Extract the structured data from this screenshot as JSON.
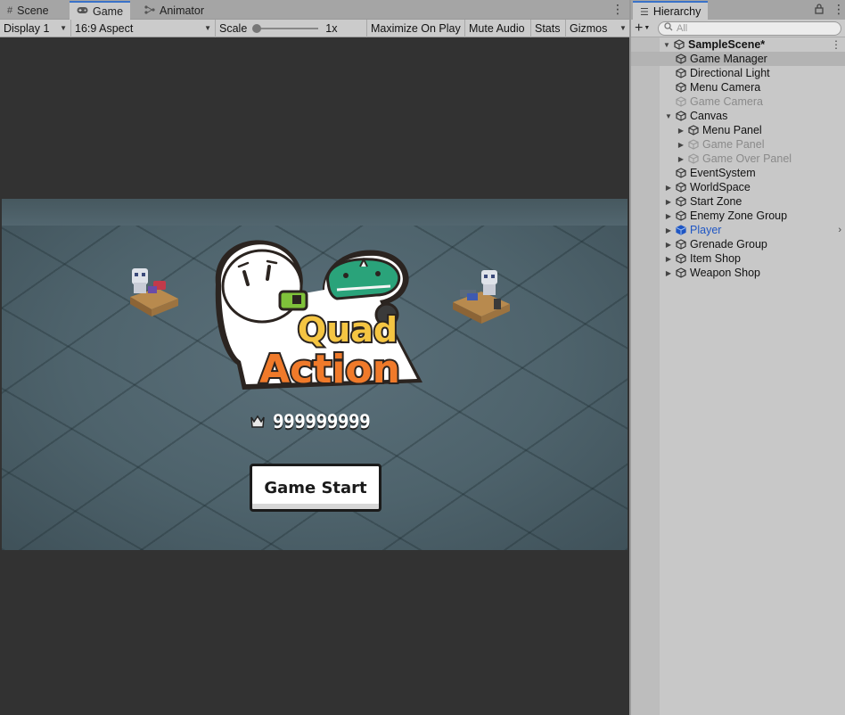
{
  "tabs": {
    "scene": "Scene",
    "game": "Game",
    "animator": "Animator"
  },
  "game_toolbar": {
    "display": "Display 1",
    "aspect": "16:9 Aspect",
    "scale_label": "Scale",
    "scale_value": "1x",
    "maximize": "Maximize On Play",
    "mute": "Mute Audio",
    "stats": "Stats",
    "gizmos": "Gizmos"
  },
  "game": {
    "logo_line1": "Quad",
    "logo_line2": "Action",
    "max_score": "999999999",
    "start_button": "Game Start"
  },
  "hierarchy": {
    "tab_label": "Hierarchy",
    "search_placeholder": "All",
    "scene_name": "SampleScene*",
    "items": [
      {
        "label": "Game Manager",
        "depth": 1,
        "arrow": "",
        "state": "selected"
      },
      {
        "label": "Directional Light",
        "depth": 1,
        "arrow": "",
        "state": "normal"
      },
      {
        "label": "Menu Camera",
        "depth": 1,
        "arrow": "",
        "state": "normal"
      },
      {
        "label": "Game Camera",
        "depth": 1,
        "arrow": "",
        "state": "disabled"
      },
      {
        "label": "Canvas",
        "depth": 1,
        "arrow": "expanded",
        "state": "normal"
      },
      {
        "label": "Menu Panel",
        "depth": 2,
        "arrow": "collapsed",
        "state": "normal"
      },
      {
        "label": "Game Panel",
        "depth": 2,
        "arrow": "collapsed",
        "state": "disabled"
      },
      {
        "label": "Game Over Panel",
        "depth": 2,
        "arrow": "collapsed",
        "state": "disabled"
      },
      {
        "label": "EventSystem",
        "depth": 1,
        "arrow": "",
        "state": "normal"
      },
      {
        "label": "WorldSpace",
        "depth": 1,
        "arrow": "collapsed",
        "state": "normal"
      },
      {
        "label": "Start Zone",
        "depth": 1,
        "arrow": "collapsed",
        "state": "normal"
      },
      {
        "label": "Enemy Zone Group",
        "depth": 1,
        "arrow": "collapsed",
        "state": "normal"
      },
      {
        "label": "Player",
        "depth": 1,
        "arrow": "collapsed",
        "state": "prefab"
      },
      {
        "label": "Grenade Group",
        "depth": 1,
        "arrow": "collapsed",
        "state": "normal"
      },
      {
        "label": "Item Shop",
        "depth": 1,
        "arrow": "collapsed",
        "state": "normal"
      },
      {
        "label": "Weapon Shop",
        "depth": 1,
        "arrow": "collapsed",
        "state": "normal"
      }
    ]
  },
  "colors": {
    "accent": "#3a72c8",
    "prefab_blue": "#1f56c4",
    "logo_orange": "#f07a2a",
    "logo_yellow": "#f5c542",
    "logo_green": "#2aa37a"
  }
}
